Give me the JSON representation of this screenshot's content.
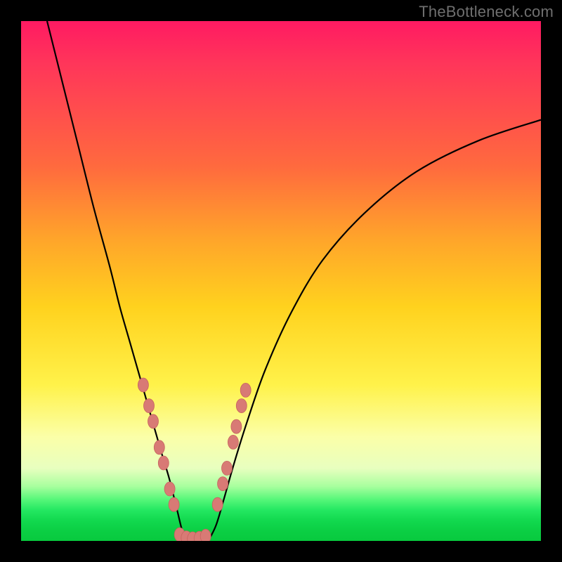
{
  "watermark": "TheBottleneck.com",
  "colors": {
    "frame": "#000000",
    "watermark": "#6f6f6f",
    "curve": "#000000",
    "marker_fill": "#d87a75",
    "marker_stroke": "#c6635e",
    "gradient_stops": [
      "#ff1a62",
      "#ff355a",
      "#ff6a3e",
      "#ffa52a",
      "#ffd21e",
      "#fff24a",
      "#fbffa8",
      "#e8ffbf",
      "#a8ff9e",
      "#57f77a",
      "#25e862",
      "#12d94f",
      "#0bcf44",
      "#08c93e"
    ]
  },
  "chart_data": {
    "type": "line",
    "title": "",
    "xlabel": "",
    "ylabel": "",
    "xlim": [
      0,
      100
    ],
    "ylim": [
      0,
      100
    ],
    "grid": false,
    "legend": false,
    "note": "Bottleneck-style V-curve. x is an arbitrary component-ratio axis (0–100); y is mismatch % where 0 = no bottleneck (bottom/green) and 100 = severe (top/red). Values are read off the plotted pixel positions since no axis ticks are shown.",
    "series": [
      {
        "name": "left-branch",
        "x": [
          5,
          8,
          11,
          14,
          17,
          19,
          21,
          23,
          25,
          27,
          28.5,
          30,
          31,
          32
        ],
        "y": [
          100,
          88,
          76,
          64,
          53,
          45,
          38,
          31,
          24,
          17,
          12,
          6,
          2,
          0
        ]
      },
      {
        "name": "right-branch",
        "x": [
          36,
          37.5,
          39,
          41,
          43.5,
          47,
          52,
          58,
          66,
          76,
          88,
          100
        ],
        "y": [
          0,
          3,
          8,
          15,
          23,
          33,
          44,
          54,
          63,
          71,
          77,
          81
        ]
      }
    ],
    "markers": {
      "name": "highlighted-points",
      "note": "Salmon ellipse markers clustered near the valley on both branches, plus a short flat run at the trough.",
      "points": [
        {
          "x": 23.5,
          "y": 30
        },
        {
          "x": 24.6,
          "y": 26
        },
        {
          "x": 25.4,
          "y": 23
        },
        {
          "x": 26.6,
          "y": 18
        },
        {
          "x": 27.4,
          "y": 15
        },
        {
          "x": 28.6,
          "y": 10
        },
        {
          "x": 29.4,
          "y": 7
        },
        {
          "x": 30.5,
          "y": 1.2
        },
        {
          "x": 31.8,
          "y": 0.6
        },
        {
          "x": 33.0,
          "y": 0.4
        },
        {
          "x": 34.3,
          "y": 0.5
        },
        {
          "x": 35.5,
          "y": 0.9
        },
        {
          "x": 37.8,
          "y": 7
        },
        {
          "x": 38.8,
          "y": 11
        },
        {
          "x": 39.6,
          "y": 14
        },
        {
          "x": 40.8,
          "y": 19
        },
        {
          "x": 41.4,
          "y": 22
        },
        {
          "x": 42.4,
          "y": 26
        },
        {
          "x": 43.2,
          "y": 29
        }
      ]
    }
  }
}
